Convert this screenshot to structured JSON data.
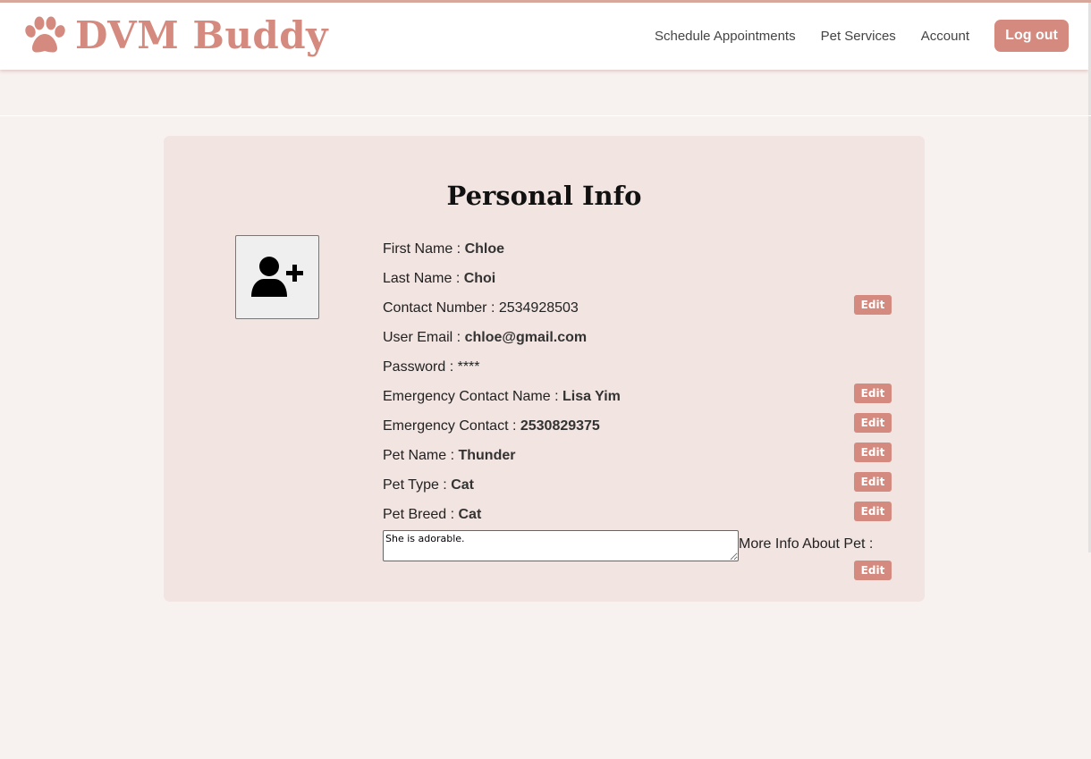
{
  "brand": {
    "name": "DVM Buddy",
    "icon": "paw-icon",
    "color": "#d48a7e"
  },
  "nav": {
    "links": [
      "Schedule Appointments",
      "Pet Services",
      "Account"
    ],
    "logout_label": "Log out"
  },
  "profile": {
    "title": "Personal Info",
    "avatar_icon": "add-user-icon",
    "fields": {
      "first_name": {
        "label": "First Name : ",
        "value": "Chloe"
      },
      "last_name": {
        "label": "Last Name : ",
        "value": "Choi"
      },
      "contact_number": {
        "label": "Contact Number : ",
        "value": "2534928503"
      },
      "user_email": {
        "label": "User Email : ",
        "value": "chloe@gmail.com"
      },
      "password": {
        "label": "Password : ",
        "value": "****"
      },
      "emergency_contact_name": {
        "label": "Emergency Contact Name : ",
        "value": "Lisa Yim"
      },
      "emergency_contact": {
        "label": "Emergency Contact : ",
        "value": "2530829375"
      },
      "pet_name": {
        "label": "Pet Name : ",
        "value": "Thunder"
      },
      "pet_type": {
        "label": "Pet Type : ",
        "value": "Cat"
      },
      "pet_breed": {
        "label": "Pet Breed : ",
        "value": "Cat"
      }
    },
    "more_info": {
      "label": "More Info About Pet :",
      "value": "She is adorable."
    },
    "edit_label": "Edit"
  }
}
